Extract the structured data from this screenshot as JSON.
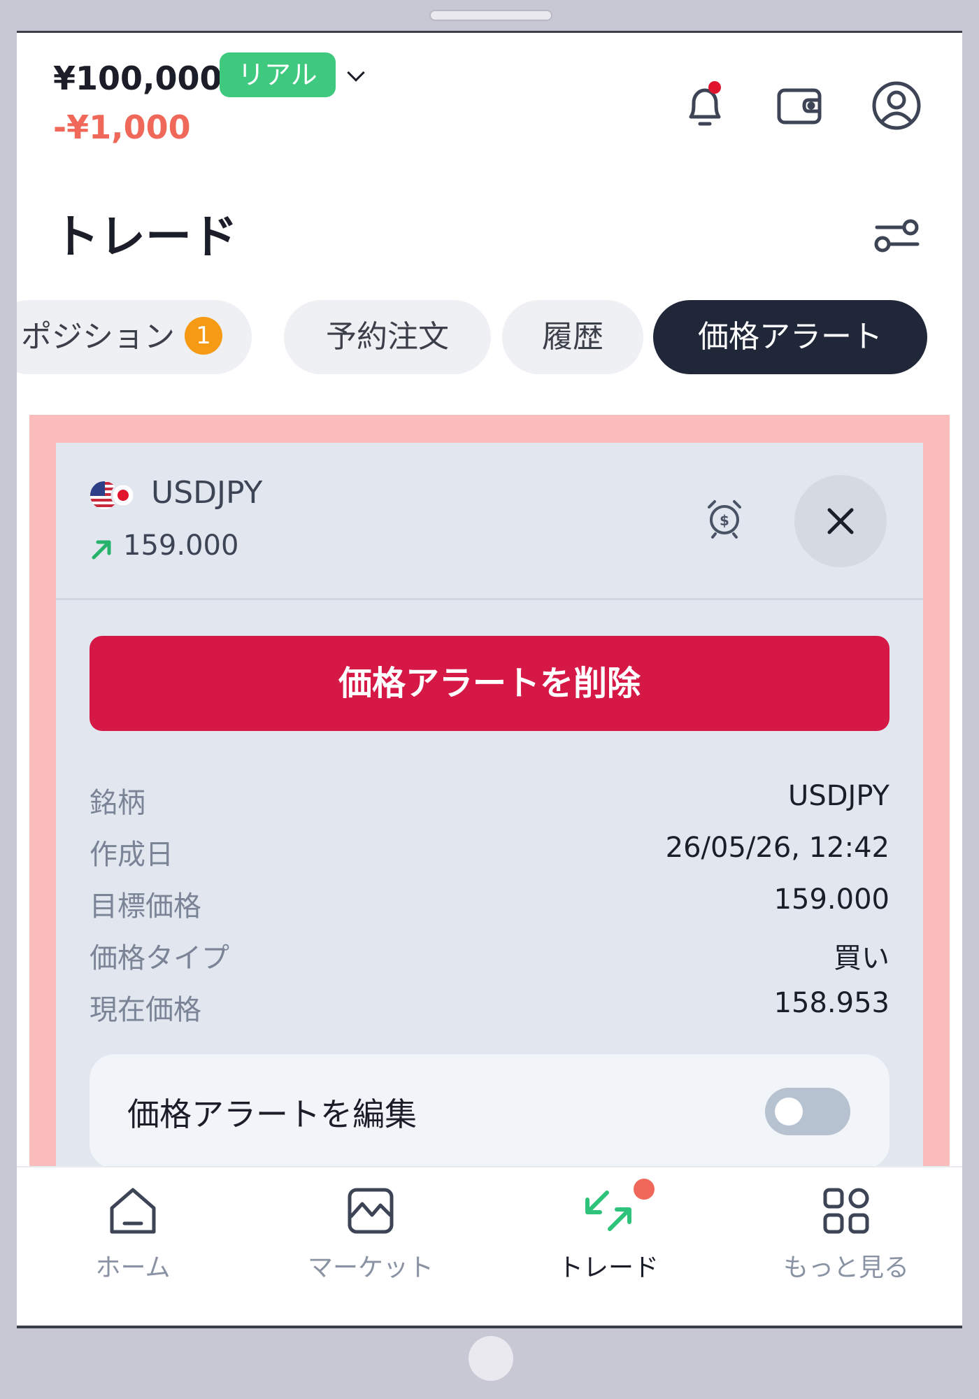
{
  "header": {
    "balance": "¥100,000",
    "account_type": "リアル",
    "pnl": "-¥1,000",
    "notification_dot_color": "#e0152d"
  },
  "page": {
    "title": "トレード"
  },
  "tabs": [
    {
      "label": "ポジション",
      "count": "1"
    },
    {
      "label": "予約注文"
    },
    {
      "label": "履歴"
    },
    {
      "label": "価格アラート",
      "active": true
    }
  ],
  "alert_card": {
    "symbol": "USDJPY",
    "target_price": "159.000",
    "delete_button": "価格アラートを削除",
    "details": [
      {
        "label": "銘柄",
        "value": "USDJPY"
      },
      {
        "label": "作成日",
        "value": "26/05/26, 12:42"
      },
      {
        "label": "目標価格",
        "value": "159.000"
      },
      {
        "label": "価格タイプ",
        "value": "買い"
      },
      {
        "label": "現在価格",
        "value": "158.953"
      }
    ],
    "edit_label": "価格アラートを編集",
    "edit_enabled": false
  },
  "bottom_nav": [
    {
      "label": "ホーム",
      "icon": "home-icon"
    },
    {
      "label": "マーケット",
      "icon": "market-chart-icon"
    },
    {
      "label": "トレード",
      "icon": "trade-arrows-icon",
      "active": true,
      "badge_dot": true
    },
    {
      "label": "もっと見る",
      "icon": "more-grid-icon"
    }
  ],
  "colors": {
    "accent_green": "#3fc97f",
    "loss_red": "#f0685a",
    "delete_red": "#d61847",
    "active_tab": "#1f2738",
    "highlight": "#fbbcbc"
  }
}
